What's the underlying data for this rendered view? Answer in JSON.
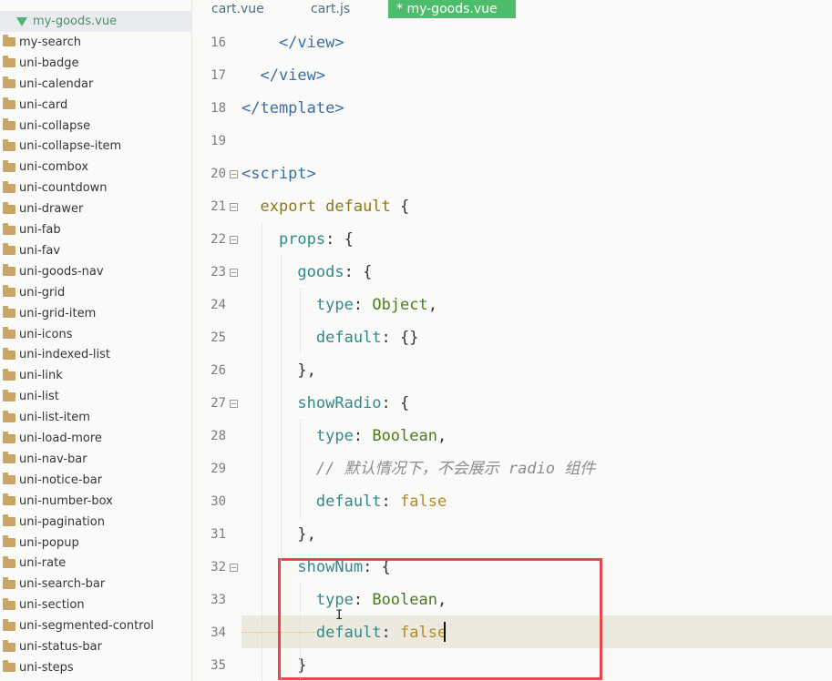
{
  "sidebar": {
    "items": [
      {
        "label": "my-goods.vue",
        "kind": "vue-file",
        "selected": true
      },
      {
        "label": "my-search",
        "kind": "folder"
      },
      {
        "label": "uni-badge",
        "kind": "folder"
      },
      {
        "label": "uni-calendar",
        "kind": "folder"
      },
      {
        "label": "uni-card",
        "kind": "folder"
      },
      {
        "label": "uni-collapse",
        "kind": "folder"
      },
      {
        "label": "uni-collapse-item",
        "kind": "folder"
      },
      {
        "label": "uni-combox",
        "kind": "folder"
      },
      {
        "label": "uni-countdown",
        "kind": "folder"
      },
      {
        "label": "uni-drawer",
        "kind": "folder"
      },
      {
        "label": "uni-fab",
        "kind": "folder"
      },
      {
        "label": "uni-fav",
        "kind": "folder"
      },
      {
        "label": "uni-goods-nav",
        "kind": "folder"
      },
      {
        "label": "uni-grid",
        "kind": "folder"
      },
      {
        "label": "uni-grid-item",
        "kind": "folder"
      },
      {
        "label": "uni-icons",
        "kind": "folder"
      },
      {
        "label": "uni-indexed-list",
        "kind": "folder"
      },
      {
        "label": "uni-link",
        "kind": "folder"
      },
      {
        "label": "uni-list",
        "kind": "folder"
      },
      {
        "label": "uni-list-item",
        "kind": "folder"
      },
      {
        "label": "uni-load-more",
        "kind": "folder"
      },
      {
        "label": "uni-nav-bar",
        "kind": "folder"
      },
      {
        "label": "uni-notice-bar",
        "kind": "folder"
      },
      {
        "label": "uni-number-box",
        "kind": "folder"
      },
      {
        "label": "uni-pagination",
        "kind": "folder"
      },
      {
        "label": "uni-popup",
        "kind": "folder"
      },
      {
        "label": "uni-rate",
        "kind": "folder"
      },
      {
        "label": "uni-search-bar",
        "kind": "folder"
      },
      {
        "label": "uni-section",
        "kind": "folder"
      },
      {
        "label": "uni-segmented-control",
        "kind": "folder"
      },
      {
        "label": "uni-status-bar",
        "kind": "folder"
      },
      {
        "label": "uni-steps",
        "kind": "folder"
      }
    ]
  },
  "tabs": [
    {
      "label": "cart.vue",
      "active": false
    },
    {
      "label": "cart.js",
      "active": false
    },
    {
      "label": "* my-goods.vue",
      "active": true
    }
  ],
  "editor": {
    "current_line": 34,
    "lines": [
      {
        "number": "16",
        "fold": false,
        "tokens": [
          {
            "t": "    ",
            "c": "punc"
          },
          {
            "t": "</view>",
            "c": "tag"
          }
        ]
      },
      {
        "number": "17",
        "fold": false,
        "tokens": [
          {
            "t": "  ",
            "c": "punc"
          },
          {
            "t": "</view>",
            "c": "tag"
          }
        ]
      },
      {
        "number": "18",
        "fold": false,
        "tokens": [
          {
            "t": "</template>",
            "c": "tag"
          }
        ]
      },
      {
        "number": "19",
        "fold": false,
        "tokens": []
      },
      {
        "number": "20",
        "fold": true,
        "tokens": [
          {
            "t": "<script>",
            "c": "tag"
          }
        ]
      },
      {
        "number": "21",
        "fold": true,
        "tokens": [
          {
            "t": "  ",
            "c": "punc"
          },
          {
            "t": "export default",
            "c": "kw"
          },
          {
            "t": " {",
            "c": "punc"
          }
        ]
      },
      {
        "number": "22",
        "fold": true,
        "tokens": [
          {
            "t": "    ",
            "c": "punc"
          },
          {
            "t": "props",
            "c": "prop"
          },
          {
            "t": ": {",
            "c": "punc"
          }
        ]
      },
      {
        "number": "23",
        "fold": true,
        "tokens": [
          {
            "t": "      ",
            "c": "punc"
          },
          {
            "t": "goods",
            "c": "prop"
          },
          {
            "t": ": {",
            "c": "punc"
          }
        ]
      },
      {
        "number": "24",
        "fold": false,
        "tokens": [
          {
            "t": "        ",
            "c": "punc"
          },
          {
            "t": "type",
            "c": "prop"
          },
          {
            "t": ": ",
            "c": "punc"
          },
          {
            "t": "Object",
            "c": "type"
          },
          {
            "t": ",",
            "c": "punc"
          }
        ]
      },
      {
        "number": "25",
        "fold": false,
        "tokens": [
          {
            "t": "        ",
            "c": "punc"
          },
          {
            "t": "default",
            "c": "prop"
          },
          {
            "t": ": {}",
            "c": "punc"
          }
        ]
      },
      {
        "number": "26",
        "fold": false,
        "tokens": [
          {
            "t": "      ",
            "c": "punc"
          },
          {
            "t": "},",
            "c": "punc"
          }
        ]
      },
      {
        "number": "27",
        "fold": true,
        "tokens": [
          {
            "t": "      ",
            "c": "punc"
          },
          {
            "t": "showRadio",
            "c": "prop"
          },
          {
            "t": ": {",
            "c": "punc"
          }
        ]
      },
      {
        "number": "28",
        "fold": false,
        "tokens": [
          {
            "t": "        ",
            "c": "punc"
          },
          {
            "t": "type",
            "c": "prop"
          },
          {
            "t": ": ",
            "c": "punc"
          },
          {
            "t": "Boolean",
            "c": "type"
          },
          {
            "t": ",",
            "c": "punc"
          }
        ]
      },
      {
        "number": "29",
        "fold": false,
        "tokens": [
          {
            "t": "        ",
            "c": "punc"
          },
          {
            "t": "// 默认情况下，不会展示 radio 组件",
            "c": "comment"
          }
        ]
      },
      {
        "number": "30",
        "fold": false,
        "tokens": [
          {
            "t": "        ",
            "c": "punc"
          },
          {
            "t": "default",
            "c": "prop"
          },
          {
            "t": ": ",
            "c": "punc"
          },
          {
            "t": "false",
            "c": "bool"
          }
        ]
      },
      {
        "number": "31",
        "fold": false,
        "tokens": [
          {
            "t": "      ",
            "c": "punc"
          },
          {
            "t": "},",
            "c": "punc"
          }
        ]
      },
      {
        "number": "32",
        "fold": true,
        "tokens": [
          {
            "t": "      ",
            "c": "punc"
          },
          {
            "t": "showNum",
            "c": "prop"
          },
          {
            "t": ": {",
            "c": "punc"
          }
        ]
      },
      {
        "number": "33",
        "fold": false,
        "tokens": [
          {
            "t": "        ",
            "c": "punc"
          },
          {
            "t": "type",
            "c": "prop"
          },
          {
            "t": ": ",
            "c": "punc"
          },
          {
            "t": "Boolean",
            "c": "type"
          },
          {
            "t": ",",
            "c": "punc"
          }
        ]
      },
      {
        "number": "34",
        "fold": false,
        "tokens": [
          {
            "t": "        ",
            "c": "punc"
          },
          {
            "t": "default",
            "c": "prop"
          },
          {
            "t": ": ",
            "c": "punc"
          },
          {
            "t": "false",
            "c": "bool"
          }
        ]
      },
      {
        "number": "35",
        "fold": false,
        "tokens": [
          {
            "t": "      ",
            "c": "punc"
          },
          {
            "t": "}",
            "c": "punc"
          }
        ]
      }
    ]
  },
  "colors": {
    "active_tab": "#4bbd6b",
    "annotation_box": "#e5484d",
    "current_line_bg": "#ece9df"
  }
}
